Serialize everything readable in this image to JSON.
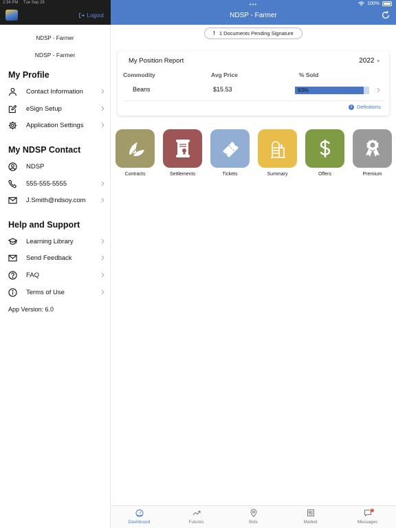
{
  "status": {
    "time": "2:34 PM",
    "date": "Tue Sep 28",
    "battery": "100%"
  },
  "header": {
    "title": "NDSP - Farmer",
    "logout_label": "Logout"
  },
  "sidebar": {
    "user_line1": "NDSP - Farmer",
    "user_line2": "NDSP - Farmer",
    "profile_title": "My Profile",
    "profile_items": [
      {
        "label": "Contact Information",
        "icon": "person-icon"
      },
      {
        "label": "eSign Setup",
        "icon": "edit-icon"
      },
      {
        "label": "Application Settings",
        "icon": "gear-icon"
      }
    ],
    "contact_title": "My NDSP Contact",
    "contact_items": [
      {
        "label": "NDSP",
        "icon": "account-circle-icon"
      },
      {
        "label": "555-555-5555",
        "icon": "phone-icon"
      },
      {
        "label": "J.Smith@ndsoy.com",
        "icon": "mail-icon"
      }
    ],
    "help_title": "Help and Support",
    "help_items": [
      {
        "label": "Learning Library",
        "icon": "graduation-cap-icon"
      },
      {
        "label": "Send Feedback",
        "icon": "mail-icon"
      },
      {
        "label": "FAQ",
        "icon": "question-icon"
      },
      {
        "label": "Terms of Use",
        "icon": "info-icon"
      }
    ],
    "app_version": "App Version: 6.0"
  },
  "main": {
    "pending_label": "1 Documents Pending Signature",
    "pending_icon": "!",
    "report": {
      "title": "My Position Report",
      "year": "2022",
      "columns": [
        "Commodity",
        "Avg Price",
        "% Sold"
      ],
      "rows": [
        {
          "commodity": "Beans",
          "avg_price": "$15.53",
          "pct_sold_label": "93%",
          "pct_sold": 93
        }
      ],
      "definitions_label": "Definitions"
    },
    "tiles": [
      {
        "label": "Contracts",
        "color": "#a39a6a",
        "icon": "leaf-icon"
      },
      {
        "label": "Settlements",
        "color": "#9e5555",
        "icon": "scroll-icon"
      },
      {
        "label": "Tickets",
        "color": "#93aed3",
        "icon": "ticket-icon"
      },
      {
        "label": "Summary",
        "color": "#e8bd4a",
        "icon": "silo-icon"
      },
      {
        "label": "Offers",
        "color": "#7f9c44",
        "icon": "dollar-icon"
      },
      {
        "label": "Premium",
        "color": "#9a9a9a",
        "icon": "award-icon"
      }
    ]
  },
  "tabbar": {
    "tabs": [
      {
        "label": "Dashboard",
        "icon": "gauge-icon"
      },
      {
        "label": "Futures",
        "icon": "trend-icon"
      },
      {
        "label": "Bids",
        "icon": "location-pin-icon"
      },
      {
        "label": "Market",
        "icon": "newspaper-icon"
      },
      {
        "label": "Messages",
        "icon": "chat-icon"
      }
    ]
  },
  "colors": {
    "accent": "#4d7cc8",
    "dark_header": "#1d1d1d",
    "bar_fill": "#4a74c4"
  }
}
